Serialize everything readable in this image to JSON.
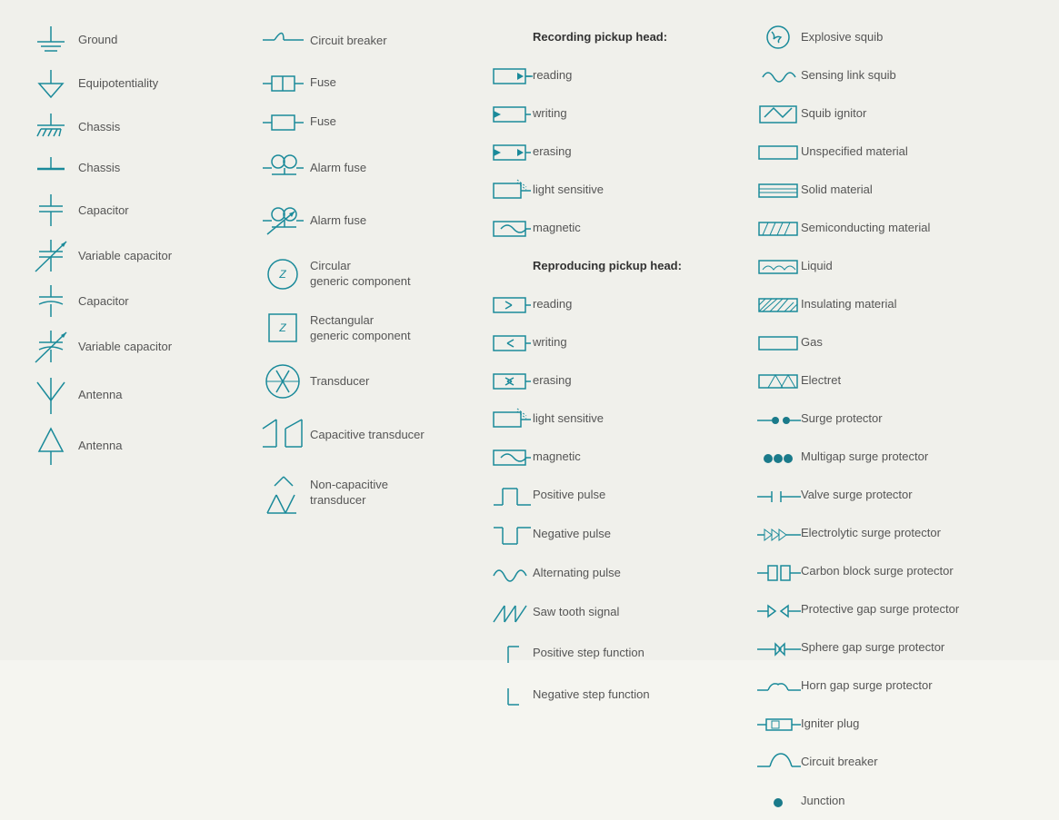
{
  "col1": {
    "items": [
      {
        "label": "Ground",
        "symbol": "ground"
      },
      {
        "label": "Equipotentiality",
        "symbol": "equipotentiality"
      },
      {
        "label": "Chassis",
        "symbol": "chassis1"
      },
      {
        "label": "Chassis",
        "symbol": "chassis2"
      },
      {
        "label": "Capacitor",
        "symbol": "capacitor"
      },
      {
        "label": "Variable capacitor",
        "symbol": "var-capacitor"
      },
      {
        "label": "Capacitor",
        "symbol": "capacitor2"
      },
      {
        "label": "Variable capacitor",
        "symbol": "var-capacitor2"
      },
      {
        "label": "Antenna",
        "symbol": "antenna1"
      },
      {
        "label": "Antenna",
        "symbol": "antenna2"
      }
    ]
  },
  "col2": {
    "items": [
      {
        "label": "Circuit breaker",
        "symbol": "circuit-breaker"
      },
      {
        "label": "Fuse",
        "symbol": "fuse1"
      },
      {
        "label": "Fuse",
        "symbol": "fuse2"
      },
      {
        "label": "Alarm fuse",
        "symbol": "alarm-fuse1"
      },
      {
        "label": "Alarm fuse",
        "symbol": "alarm-fuse2"
      },
      {
        "label": "Circular\ngeneric component",
        "symbol": "circular-generic"
      },
      {
        "label": "Rectangular\ngeneric component",
        "symbol": "rect-generic"
      },
      {
        "label": "Transducer",
        "symbol": "transducer"
      },
      {
        "label": "Capacitive transducer",
        "symbol": "cap-transducer"
      },
      {
        "label": "Non-capacitive\ntransducer",
        "symbol": "noncap-transducer"
      }
    ]
  },
  "col3": {
    "items": [
      {
        "label": "Recording pickup head:",
        "symbol": ""
      },
      {
        "label": "reading",
        "symbol": "reading1"
      },
      {
        "label": "writing",
        "symbol": "writing1"
      },
      {
        "label": "erasing",
        "symbol": "erasing1"
      },
      {
        "label": "light sensitive",
        "symbol": "lightsens1"
      },
      {
        "label": "magnetic",
        "symbol": "magnetic1"
      },
      {
        "label": "Reproducing pickup head:",
        "symbol": ""
      },
      {
        "label": "reading",
        "symbol": "reading2"
      },
      {
        "label": "writing",
        "symbol": "writing2"
      },
      {
        "label": "erasing",
        "symbol": "erasing2"
      },
      {
        "label": "light sensitive",
        "symbol": "lightsens2"
      },
      {
        "label": "magnetic",
        "symbol": "magnetic2"
      },
      {
        "label": "Positive pulse",
        "symbol": "pos-pulse"
      },
      {
        "label": "Negative pulse",
        "symbol": "neg-pulse"
      },
      {
        "label": "Alternating pulse",
        "symbol": "alt-pulse"
      },
      {
        "label": "Saw tooth signal",
        "symbol": "sawtooth"
      },
      {
        "label": "Positive step function",
        "symbol": "pos-step"
      },
      {
        "label": "Negative step function",
        "symbol": "neg-step"
      }
    ]
  },
  "col4": {
    "items": [
      {
        "label": "Explosive squib",
        "symbol": "explosive-squib"
      },
      {
        "label": "Sensing link squib",
        "symbol": "sensing-squib"
      },
      {
        "label": "Squib ignitor",
        "symbol": "squib-ignitor"
      },
      {
        "label": "Unspecified material",
        "symbol": "unspec-material"
      },
      {
        "label": "Solid material",
        "symbol": "solid-material"
      },
      {
        "label": "Semiconducting material",
        "symbol": "semi-material"
      },
      {
        "label": "Liquid",
        "symbol": "liquid"
      },
      {
        "label": "Insulating material",
        "symbol": "insulating"
      },
      {
        "label": "Gas",
        "symbol": "gas"
      },
      {
        "label": "Electret",
        "symbol": "electret"
      },
      {
        "label": "Surge protector",
        "symbol": "surge-protector"
      },
      {
        "label": "Multigap surge protector",
        "symbol": "multigap-surge"
      },
      {
        "label": "Valve surge protector",
        "symbol": "valve-surge"
      },
      {
        "label": "Electrolytic surge protector",
        "symbol": "electrolytic-surge"
      },
      {
        "label": "Carbon block surge protector",
        "symbol": "carbon-surge"
      },
      {
        "label": "Protective gap surge protector",
        "symbol": "prot-gap-surge"
      },
      {
        "label": "Sphere gap surge protector",
        "symbol": "sphere-gap-surge"
      },
      {
        "label": "Horn gap surge protector",
        "symbol": "horn-gap-surge"
      },
      {
        "label": "Igniter plug",
        "symbol": "igniter-plug"
      },
      {
        "label": "Circuit breaker",
        "symbol": "circuit-breaker2"
      },
      {
        "label": "Junction",
        "symbol": "junction"
      }
    ]
  }
}
